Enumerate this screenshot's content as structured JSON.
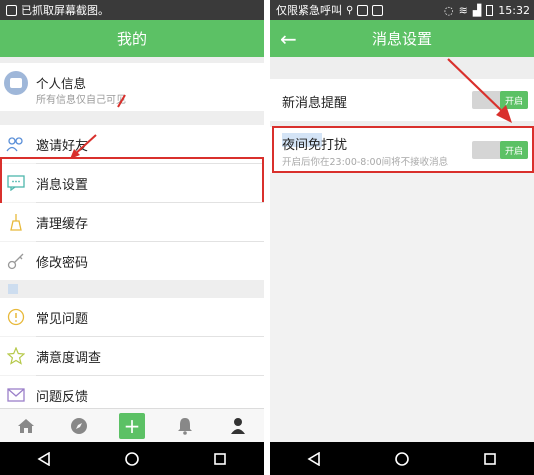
{
  "left": {
    "statusbar": {
      "text": "已抓取屏幕截图。"
    },
    "header": {
      "title": "我的"
    },
    "profile": {
      "title": "个人信息",
      "subtitle": "所有信息仅自己可见"
    },
    "menu": [
      {
        "label": "邀请好友",
        "icon": "invite-friends-icon"
      },
      {
        "label": "消息设置",
        "icon": "message-settings-icon"
      },
      {
        "label": "清理缓存",
        "icon": "clear-cache-icon"
      },
      {
        "label": "修改密码",
        "icon": "change-password-icon"
      },
      {
        "label": "常见问题",
        "icon": "faq-icon"
      },
      {
        "label": "满意度调查",
        "icon": "satisfaction-survey-icon"
      },
      {
        "label": "问题反馈",
        "icon": "feedback-icon"
      }
    ],
    "tabs": [
      "home-icon",
      "compass-icon",
      "plus-icon",
      "bell-icon",
      "user-icon"
    ],
    "plus_label": "+"
  },
  "right": {
    "statusbar": {
      "carrier": "仅限紧急呼叫",
      "time": "15:32"
    },
    "header": {
      "title": "消息设置",
      "back": "←"
    },
    "settings": [
      {
        "title": "新消息提醒",
        "toggle": "开启"
      },
      {
        "title": "夜间免打扰",
        "subtitle": "开启后你在23:00-8:00间将不接收消息",
        "toggle": "开启"
      }
    ]
  },
  "colors": {
    "accent": "#5cc165",
    "highlight": "#d9302c"
  }
}
